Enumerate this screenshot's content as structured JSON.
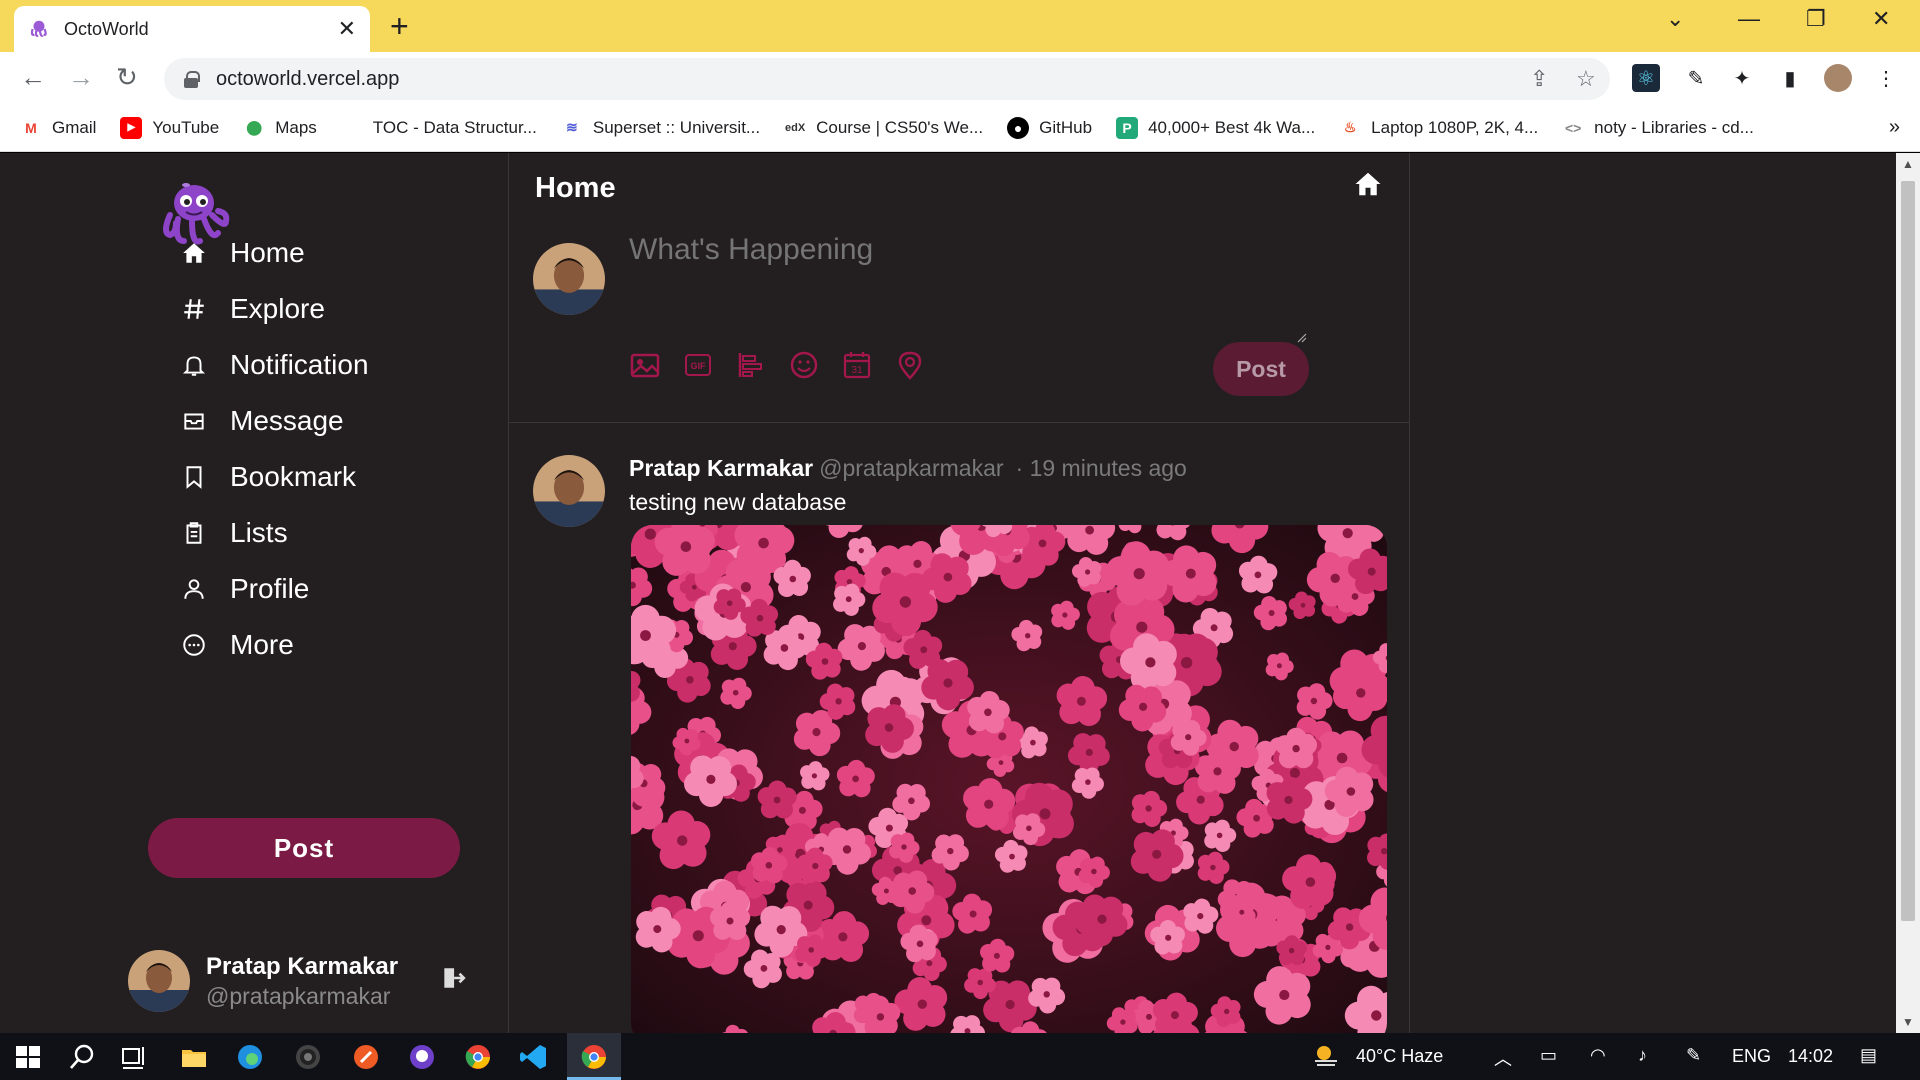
{
  "browser": {
    "tab_title": "OctoWorld",
    "tab_close": "✕",
    "new_tab": "+",
    "url": "octoworld.vercel.app",
    "bookmarks": [
      {
        "label": "Gmail",
        "icon": "gmail-icon"
      },
      {
        "label": "YouTube",
        "icon": "youtube-icon"
      },
      {
        "label": "Maps",
        "icon": "maps-icon"
      },
      {
        "label": "TOC - Data Structur...",
        "icon": "page-icon"
      },
      {
        "label": "Superset :: Universit...",
        "icon": "superset-icon"
      },
      {
        "label": "Course | CS50's We...",
        "icon": "edx-icon"
      },
      {
        "label": "GitHub",
        "icon": "github-icon"
      },
      {
        "label": "40,000+ Best 4k Wa...",
        "icon": "wallpaper-icon"
      },
      {
        "label": "Laptop 1080P, 2K, 4...",
        "icon": "fire-icon"
      },
      {
        "label": "noty - Libraries - cd...",
        "icon": "code-icon"
      }
    ],
    "more_bookmarks": "»"
  },
  "app": {
    "accent_color": "#7b1a44",
    "background_color": "#231f20",
    "nav": [
      {
        "label": "Home",
        "icon": "home-icon"
      },
      {
        "label": "Explore",
        "icon": "hash-icon"
      },
      {
        "label": "Notification",
        "icon": "bell-icon"
      },
      {
        "label": "Message",
        "icon": "inbox-icon"
      },
      {
        "label": "Bookmark",
        "icon": "bookmark-icon"
      },
      {
        "label": "Lists",
        "icon": "clipboard-icon"
      },
      {
        "label": "Profile",
        "icon": "user-icon"
      },
      {
        "label": "More",
        "icon": "more-circle-icon"
      }
    ],
    "post_button": "Post",
    "account": {
      "name": "Pratap Karmakar",
      "handle": "@pratapkarmakar"
    },
    "main": {
      "title": "Home",
      "composer": {
        "placeholder": "What's Happening",
        "post_button": "Post",
        "tools": [
          "image-icon",
          "gif-icon",
          "poll-icon",
          "emoji-icon",
          "calendar-icon",
          "location-icon"
        ]
      },
      "post": {
        "name": "Pratap Karmakar",
        "handle": "@pratapkarmakar",
        "time": "· 19 minutes ago",
        "text": "testing new database"
      }
    }
  },
  "taskbar": {
    "weather": "40°C  Haze",
    "language": "ENG",
    "time": "14:02"
  }
}
